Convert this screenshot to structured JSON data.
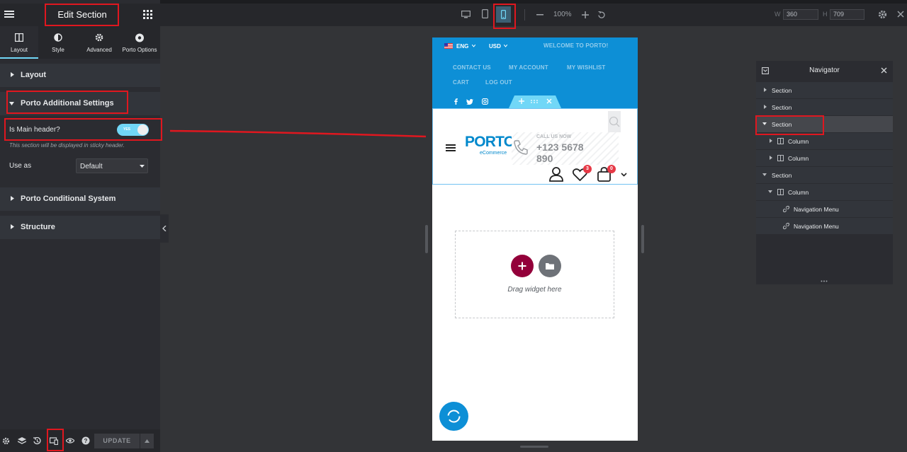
{
  "panel": {
    "title": "Edit Section",
    "tabs": [
      {
        "label": "Layout",
        "icon": "layout-icon",
        "active": true
      },
      {
        "label": "Style",
        "icon": "style-icon"
      },
      {
        "label": "Advanced",
        "icon": "gear-icon"
      },
      {
        "label": "Porto Options",
        "icon": "porto-icon"
      }
    ],
    "sections": {
      "layout": "Layout",
      "porto_additional": "Porto Additional Settings",
      "porto_conditional": "Porto Conditional System",
      "structure": "Structure"
    },
    "is_main_header": {
      "label": "Is Main header?",
      "toggle_text": "YES",
      "checked": true,
      "hint": "This section will be displayed in sticky header."
    },
    "use_as": {
      "label": "Use as",
      "value": "Default"
    },
    "update_label": "UPDATE"
  },
  "toolbar": {
    "zoom": "100%",
    "width_label": "W",
    "width_value": "360",
    "height_label": "H",
    "height_value": "709",
    "active_device": "mobile"
  },
  "preview": {
    "lang": "ENG",
    "currency": "USD",
    "welcome": "WELCOME TO PORTO!",
    "links": [
      "CONTACT US",
      "MY ACCOUNT",
      "MY WISHLIST",
      "CART",
      "LOG OUT"
    ],
    "logo": "PORTO",
    "logo_sub": "eCommerce",
    "call_label": "CALL US NOW",
    "phone_line1": "+123 5678",
    "phone_line2": "890",
    "wishlist_count": "3",
    "cart_count": "0",
    "drag_text": "Drag widget here"
  },
  "navigator": {
    "title": "Navigator",
    "items": [
      {
        "label": "Section"
      },
      {
        "label": "Section"
      },
      {
        "label": "Section",
        "selected": true
      },
      {
        "label": "Column"
      },
      {
        "label": "Column"
      },
      {
        "label": "Section"
      },
      {
        "label": "Column"
      },
      {
        "label": "Navigation Menu"
      },
      {
        "label": "Navigation Menu"
      }
    ]
  },
  "colors": {
    "annotation_red": "#e0171f",
    "toggle_blue": "#71d7f7",
    "topbar_blue": "#0d8fd6",
    "add_button": "#93003a",
    "porto_blue": "#0088cc"
  }
}
